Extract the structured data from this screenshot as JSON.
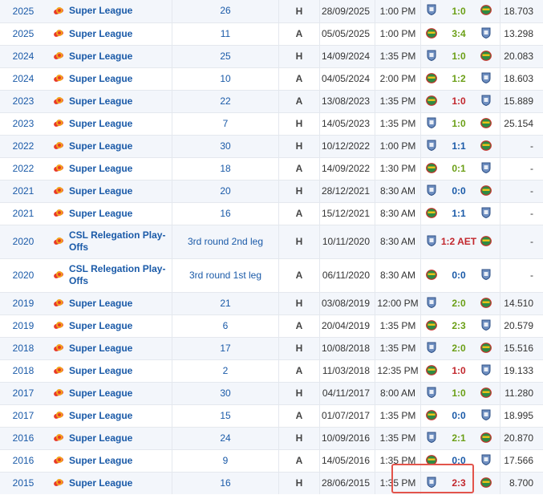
{
  "colors": {
    "link": "#1a5aa8",
    "win": "#6b9f16",
    "draw": "#1a5aa8",
    "loss": "#c2272d",
    "highlight": "#e3544b"
  },
  "icons": {
    "competition": "csl-logo-icon",
    "team_a": "blue-shield-crest-icon",
    "team_b": "green-red-oval-crest-icon"
  },
  "rows": [
    {
      "season": "2025",
      "competition": "Super League",
      "round": "26",
      "venue": "H",
      "date": "28/09/2025",
      "time": "1:00 PM",
      "score": "1:0",
      "result": "win",
      "attendance": "18.703"
    },
    {
      "season": "2025",
      "competition": "Super League",
      "round": "11",
      "venue": "A",
      "date": "05/05/2025",
      "time": "1:00 PM",
      "score": "3:4",
      "result": "win",
      "attendance": "13.298"
    },
    {
      "season": "2024",
      "competition": "Super League",
      "round": "25",
      "venue": "H",
      "date": "14/09/2024",
      "time": "1:35 PM",
      "score": "1:0",
      "result": "win",
      "attendance": "20.083"
    },
    {
      "season": "2024",
      "competition": "Super League",
      "round": "10",
      "venue": "A",
      "date": "04/05/2024",
      "time": "2:00 PM",
      "score": "1:2",
      "result": "win",
      "attendance": "18.603"
    },
    {
      "season": "2023",
      "competition": "Super League",
      "round": "22",
      "venue": "A",
      "date": "13/08/2023",
      "time": "1:35 PM",
      "score": "1:0",
      "result": "loss",
      "attendance": "15.889"
    },
    {
      "season": "2023",
      "competition": "Super League",
      "round": "7",
      "venue": "H",
      "date": "14/05/2023",
      "time": "1:35 PM",
      "score": "1:0",
      "result": "win",
      "attendance": "25.154"
    },
    {
      "season": "2022",
      "competition": "Super League",
      "round": "30",
      "venue": "H",
      "date": "10/12/2022",
      "time": "1:00 PM",
      "score": "1:1",
      "result": "draw",
      "attendance": "-"
    },
    {
      "season": "2022",
      "competition": "Super League",
      "round": "18",
      "venue": "A",
      "date": "14/09/2022",
      "time": "1:30 PM",
      "score": "0:1",
      "result": "win",
      "attendance": "-"
    },
    {
      "season": "2021",
      "competition": "Super League",
      "round": "20",
      "venue": "H",
      "date": "28/12/2021",
      "time": "8:30 AM",
      "score": "0:0",
      "result": "draw",
      "attendance": "-"
    },
    {
      "season": "2021",
      "competition": "Super League",
      "round": "16",
      "venue": "A",
      "date": "15/12/2021",
      "time": "8:30 AM",
      "score": "1:1",
      "result": "draw",
      "attendance": "-"
    },
    {
      "season": "2020",
      "competition": "CSL Relegation Play-Offs",
      "round": "3rd round 2nd leg",
      "venue": "H",
      "date": "10/11/2020",
      "time": "8:30 AM",
      "score": "1:2 AET",
      "result": "loss",
      "attendance": "-"
    },
    {
      "season": "2020",
      "competition": "CSL Relegation Play-Offs",
      "round": "3rd round 1st leg",
      "venue": "A",
      "date": "06/11/2020",
      "time": "8:30 AM",
      "score": "0:0",
      "result": "draw",
      "attendance": "-"
    },
    {
      "season": "2019",
      "competition": "Super League",
      "round": "21",
      "venue": "H",
      "date": "03/08/2019",
      "time": "12:00 PM",
      "score": "2:0",
      "result": "win",
      "attendance": "14.510"
    },
    {
      "season": "2019",
      "competition": "Super League",
      "round": "6",
      "venue": "A",
      "date": "20/04/2019",
      "time": "1:35 PM",
      "score": "2:3",
      "result": "win",
      "attendance": "20.579"
    },
    {
      "season": "2018",
      "competition": "Super League",
      "round": "17",
      "venue": "H",
      "date": "10/08/2018",
      "time": "1:35 PM",
      "score": "2:0",
      "result": "win",
      "attendance": "15.516"
    },
    {
      "season": "2018",
      "competition": "Super League",
      "round": "2",
      "venue": "A",
      "date": "11/03/2018",
      "time": "12:35 PM",
      "score": "1:0",
      "result": "loss",
      "attendance": "19.133"
    },
    {
      "season": "2017",
      "competition": "Super League",
      "round": "30",
      "venue": "H",
      "date": "04/11/2017",
      "time": "8:00 AM",
      "score": "1:0",
      "result": "win",
      "attendance": "11.280"
    },
    {
      "season": "2017",
      "competition": "Super League",
      "round": "15",
      "venue": "A",
      "date": "01/07/2017",
      "time": "1:35 PM",
      "score": "0:0",
      "result": "draw",
      "attendance": "18.995"
    },
    {
      "season": "2016",
      "competition": "Super League",
      "round": "24",
      "venue": "H",
      "date": "10/09/2016",
      "time": "1:35 PM",
      "score": "2:1",
      "result": "win",
      "attendance": "20.870"
    },
    {
      "season": "2016",
      "competition": "Super League",
      "round": "9",
      "venue": "A",
      "date": "14/05/2016",
      "time": "1:35 PM",
      "score": "0:0",
      "result": "draw",
      "attendance": "17.566"
    },
    {
      "season": "2015",
      "competition": "Super League",
      "round": "16",
      "venue": "H",
      "date": "28/06/2015",
      "time": "1:35 PM",
      "score": "2:3",
      "result": "loss",
      "attendance": "8.700"
    }
  ]
}
